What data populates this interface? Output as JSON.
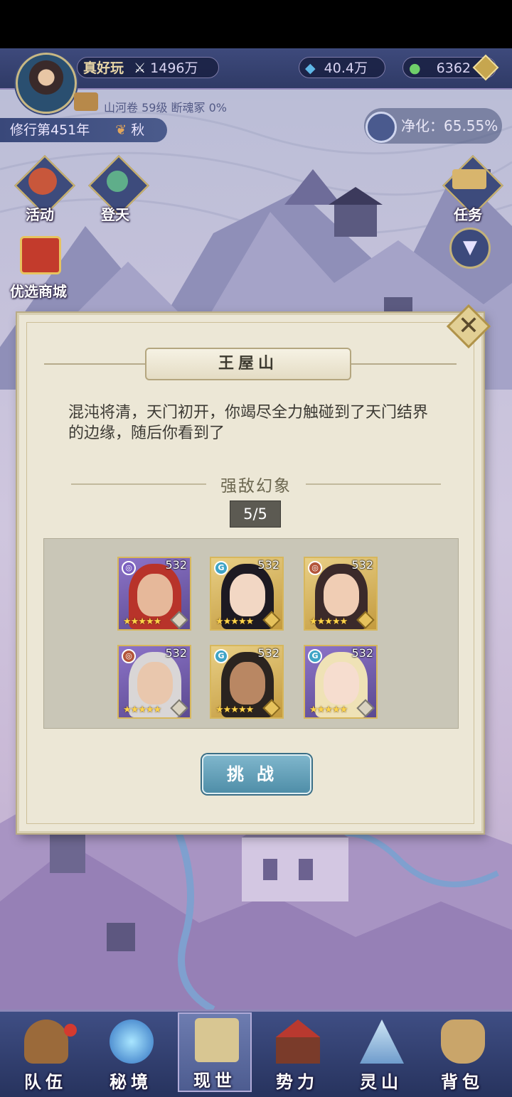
{
  "header": {
    "player_name": "真好玩",
    "power_value": "1496万",
    "crystal_value": "40.4万",
    "jade_value": "6362",
    "chapter_info": "山河卷 59级 断魂冢 0%",
    "year_text": "修行第451年",
    "season": "秋",
    "purify_text": "净化：65.55%"
  },
  "side_menu": {
    "activity": "活动",
    "ascend": "登天",
    "quest": "任务",
    "shop": "优选商城"
  },
  "dialog": {
    "title": "王屋山",
    "description": "混沌将清，天门初开，你竭尽全力触碰到了天门结界的边缘，随后你看到了",
    "section_title": "强敌幻象",
    "counter": "5/5",
    "challenge_label": "挑战",
    "enemies": [
      {
        "level": "532",
        "element": "◎",
        "frame": "purple",
        "stars": 5
      },
      {
        "level": "532",
        "element": "G",
        "frame": "gold",
        "stars": 5
      },
      {
        "level": "532",
        "element": "◎",
        "frame": "gold",
        "stars": 5
      },
      {
        "level": "532",
        "element": "◎",
        "frame": "purple",
        "stars": 5
      },
      {
        "level": "532",
        "element": "G",
        "frame": "gold",
        "stars": 5
      },
      {
        "level": "532",
        "element": "G",
        "frame": "purple",
        "stars": 5
      }
    ]
  },
  "bottom_nav": {
    "team": "队伍",
    "secret": "秘境",
    "world": "现世",
    "faction": "势力",
    "spirit": "灵山",
    "bag": "背包"
  },
  "colors": {
    "panel_bg": "#ece7d6",
    "card_gold": "#d7b75c",
    "card_purple": "#7a63b6",
    "button_blue": "#5f9fb8",
    "nav_bg": "#2f3c6c"
  }
}
